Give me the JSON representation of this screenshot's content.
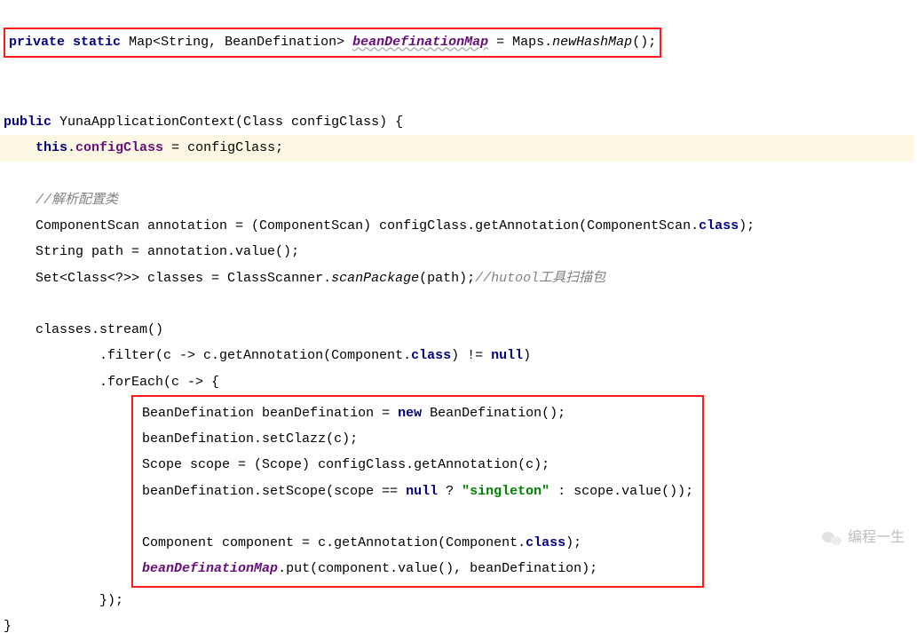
{
  "line1": {
    "kw_private": "private",
    "kw_static": "static",
    "type": "Map<String, BeanDefination>",
    "field": "beanDefinationMap",
    "assign": " = Maps.",
    "call": "newHashMap",
    "tail": "();"
  },
  "line_ctor": {
    "kw_public": "public",
    "name": " YunaApplicationContext(Class configClass) {"
  },
  "line_assign": {
    "kw_this": "this",
    "dot": ".",
    "field": "configClass",
    "rest": " = configClass;"
  },
  "comment1": "//解析配置类",
  "line_cs": {
    "p1": "ComponentScan annotation = (ComponentScan) configClass.getAnnotation(ComponentScan.",
    "kw_class": "class",
    "p2": ");"
  },
  "line_path": "String path = annotation.value();",
  "line_set": {
    "p1": "Set<Class<?>> classes = ClassScanner.",
    "call": "scanPackage",
    "p2": "(path);",
    "comment": "//hutool工具扫描包"
  },
  "line_stream": "classes.stream()",
  "line_filter": {
    "p1": ".filter(c -> c.getAnnotation(Component.",
    "kw_class": "class",
    "p2": ") != ",
    "kw_null": "null",
    "p3": ")"
  },
  "line_foreach": ".forEach(c -> {",
  "block": {
    "l1": {
      "p1": "BeanDefination beanDefination = ",
      "kw_new": "new",
      "p2": " BeanDefination();"
    },
    "l2": "beanDefination.setClazz(c);",
    "l3": "Scope scope = (Scope) configClass.getAnnotation(c);",
    "l4": {
      "p1": "beanDefination.setScope(scope == ",
      "kw_null": "null",
      "p2": " ? ",
      "str": "\"singleton\"",
      "p3": " : scope.value());"
    },
    "l5": {
      "p1": "Component component = c.getAnnotation(Component.",
      "kw_class": "class",
      "p2": ");"
    },
    "l6": {
      "field": "beanDefinationMap",
      "rest": ".put(component.value(), beanDefination);"
    }
  },
  "line_close_foreach": "});",
  "line_close_ctor": "}",
  "watermark": "编程一生"
}
